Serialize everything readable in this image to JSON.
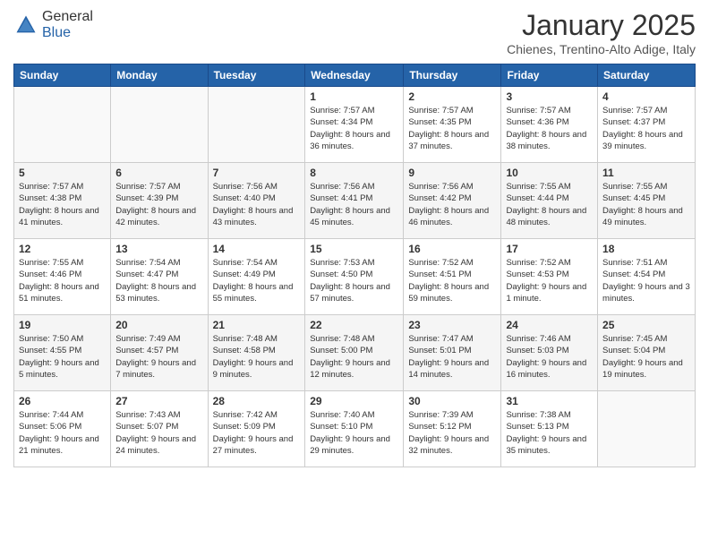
{
  "header": {
    "logo_general": "General",
    "logo_blue": "Blue",
    "month_title": "January 2025",
    "location": "Chienes, Trentino-Alto Adige, Italy"
  },
  "days_of_week": [
    "Sunday",
    "Monday",
    "Tuesday",
    "Wednesday",
    "Thursday",
    "Friday",
    "Saturday"
  ],
  "weeks": [
    [
      {
        "day": "",
        "text": ""
      },
      {
        "day": "",
        "text": ""
      },
      {
        "day": "",
        "text": ""
      },
      {
        "day": "1",
        "text": "Sunrise: 7:57 AM\nSunset: 4:34 PM\nDaylight: 8 hours and 36 minutes."
      },
      {
        "day": "2",
        "text": "Sunrise: 7:57 AM\nSunset: 4:35 PM\nDaylight: 8 hours and 37 minutes."
      },
      {
        "day": "3",
        "text": "Sunrise: 7:57 AM\nSunset: 4:36 PM\nDaylight: 8 hours and 38 minutes."
      },
      {
        "day": "4",
        "text": "Sunrise: 7:57 AM\nSunset: 4:37 PM\nDaylight: 8 hours and 39 minutes."
      }
    ],
    [
      {
        "day": "5",
        "text": "Sunrise: 7:57 AM\nSunset: 4:38 PM\nDaylight: 8 hours and 41 minutes."
      },
      {
        "day": "6",
        "text": "Sunrise: 7:57 AM\nSunset: 4:39 PM\nDaylight: 8 hours and 42 minutes."
      },
      {
        "day": "7",
        "text": "Sunrise: 7:56 AM\nSunset: 4:40 PM\nDaylight: 8 hours and 43 minutes."
      },
      {
        "day": "8",
        "text": "Sunrise: 7:56 AM\nSunset: 4:41 PM\nDaylight: 8 hours and 45 minutes."
      },
      {
        "day": "9",
        "text": "Sunrise: 7:56 AM\nSunset: 4:42 PM\nDaylight: 8 hours and 46 minutes."
      },
      {
        "day": "10",
        "text": "Sunrise: 7:55 AM\nSunset: 4:44 PM\nDaylight: 8 hours and 48 minutes."
      },
      {
        "day": "11",
        "text": "Sunrise: 7:55 AM\nSunset: 4:45 PM\nDaylight: 8 hours and 49 minutes."
      }
    ],
    [
      {
        "day": "12",
        "text": "Sunrise: 7:55 AM\nSunset: 4:46 PM\nDaylight: 8 hours and 51 minutes."
      },
      {
        "day": "13",
        "text": "Sunrise: 7:54 AM\nSunset: 4:47 PM\nDaylight: 8 hours and 53 minutes."
      },
      {
        "day": "14",
        "text": "Sunrise: 7:54 AM\nSunset: 4:49 PM\nDaylight: 8 hours and 55 minutes."
      },
      {
        "day": "15",
        "text": "Sunrise: 7:53 AM\nSunset: 4:50 PM\nDaylight: 8 hours and 57 minutes."
      },
      {
        "day": "16",
        "text": "Sunrise: 7:52 AM\nSunset: 4:51 PM\nDaylight: 8 hours and 59 minutes."
      },
      {
        "day": "17",
        "text": "Sunrise: 7:52 AM\nSunset: 4:53 PM\nDaylight: 9 hours and 1 minute."
      },
      {
        "day": "18",
        "text": "Sunrise: 7:51 AM\nSunset: 4:54 PM\nDaylight: 9 hours and 3 minutes."
      }
    ],
    [
      {
        "day": "19",
        "text": "Sunrise: 7:50 AM\nSunset: 4:55 PM\nDaylight: 9 hours and 5 minutes."
      },
      {
        "day": "20",
        "text": "Sunrise: 7:49 AM\nSunset: 4:57 PM\nDaylight: 9 hours and 7 minutes."
      },
      {
        "day": "21",
        "text": "Sunrise: 7:48 AM\nSunset: 4:58 PM\nDaylight: 9 hours and 9 minutes."
      },
      {
        "day": "22",
        "text": "Sunrise: 7:48 AM\nSunset: 5:00 PM\nDaylight: 9 hours and 12 minutes."
      },
      {
        "day": "23",
        "text": "Sunrise: 7:47 AM\nSunset: 5:01 PM\nDaylight: 9 hours and 14 minutes."
      },
      {
        "day": "24",
        "text": "Sunrise: 7:46 AM\nSunset: 5:03 PM\nDaylight: 9 hours and 16 minutes."
      },
      {
        "day": "25",
        "text": "Sunrise: 7:45 AM\nSunset: 5:04 PM\nDaylight: 9 hours and 19 minutes."
      }
    ],
    [
      {
        "day": "26",
        "text": "Sunrise: 7:44 AM\nSunset: 5:06 PM\nDaylight: 9 hours and 21 minutes."
      },
      {
        "day": "27",
        "text": "Sunrise: 7:43 AM\nSunset: 5:07 PM\nDaylight: 9 hours and 24 minutes."
      },
      {
        "day": "28",
        "text": "Sunrise: 7:42 AM\nSunset: 5:09 PM\nDaylight: 9 hours and 27 minutes."
      },
      {
        "day": "29",
        "text": "Sunrise: 7:40 AM\nSunset: 5:10 PM\nDaylight: 9 hours and 29 minutes."
      },
      {
        "day": "30",
        "text": "Sunrise: 7:39 AM\nSunset: 5:12 PM\nDaylight: 9 hours and 32 minutes."
      },
      {
        "day": "31",
        "text": "Sunrise: 7:38 AM\nSunset: 5:13 PM\nDaylight: 9 hours and 35 minutes."
      },
      {
        "day": "",
        "text": ""
      }
    ]
  ]
}
